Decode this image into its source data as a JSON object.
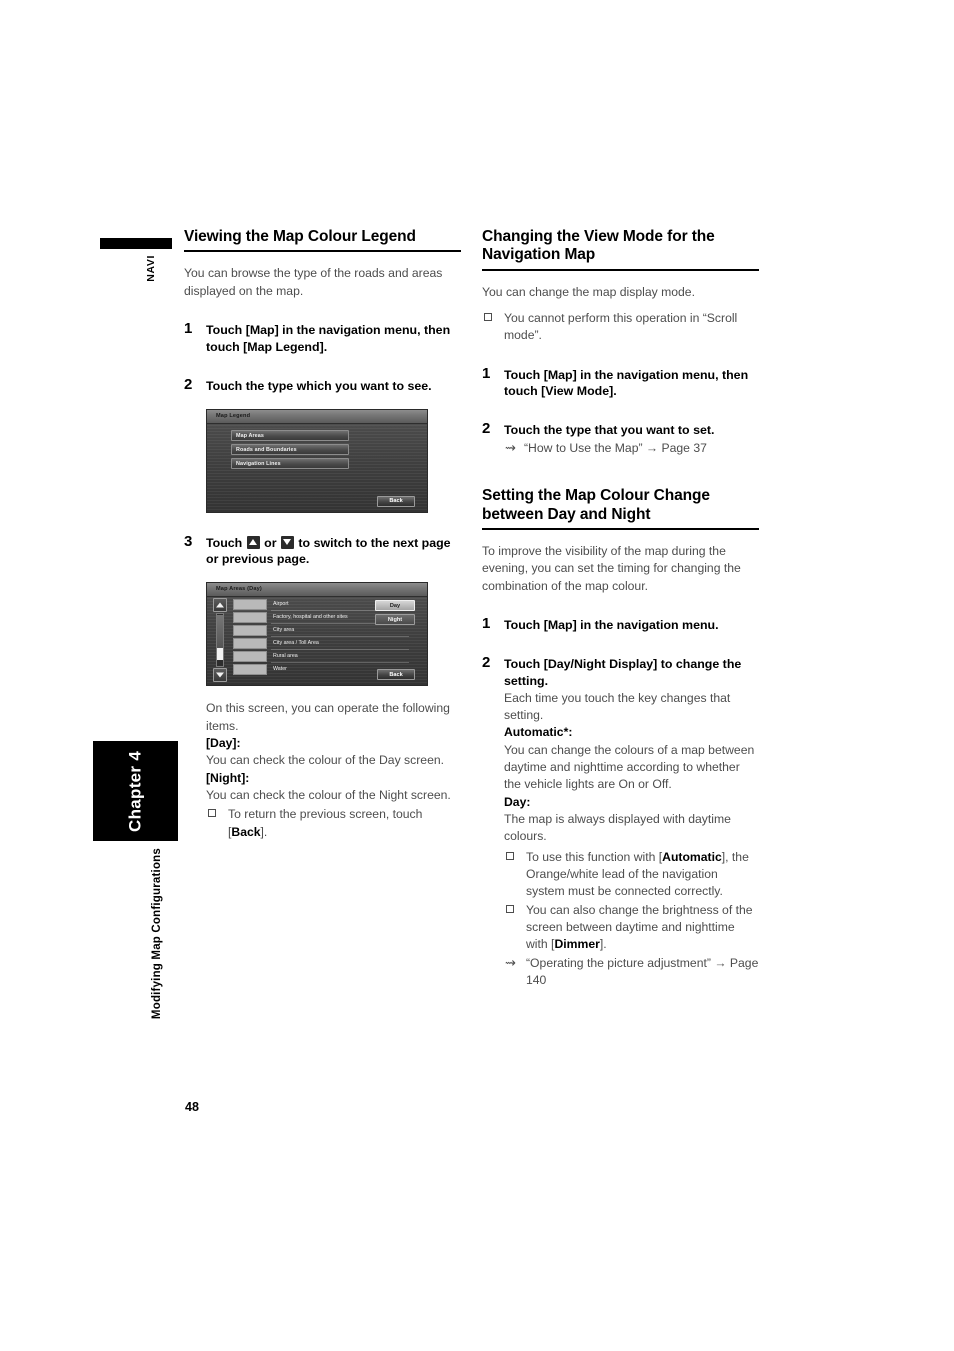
{
  "margin": {
    "navi_label": "NAVI",
    "chapter_tab": "Chapter 4",
    "chapter_subtitle": "Modifying Map Configurations",
    "page_number": "48"
  },
  "left_column": {
    "section_title": "Viewing the Map Colour Legend",
    "intro": "You can browse the type of the roads and areas displayed on the map.",
    "step1_num": "1",
    "step1_text": "Touch [Map] in the navigation menu, then touch [Map Legend].",
    "step2_num": "2",
    "step2_text": "Touch the type which you want to see.",
    "step3_num": "3",
    "step3_text_a": "Touch ",
    "step3_text_b": " or ",
    "step3_text_c": " to switch to the next page or previous page.",
    "after_shot_intro": "On this screen, you can operate the following items.",
    "day_label": "[Day]:",
    "day_text": "You can check the colour of the Day screen.",
    "night_label": "[Night]:",
    "night_text": "You can check the colour of the Night screen.",
    "note_back_a": "To return the previous screen, touch",
    "note_back_b": "[",
    "note_back_bold": "Back",
    "note_back_c": "]."
  },
  "shot_map_legend": {
    "title": "Map Legend",
    "buttons": [
      "Map Areas",
      "Roads and Boundaries",
      "Navigation Lines"
    ],
    "back_label": "Back"
  },
  "shot_map_areas": {
    "title": "Map Areas (Day)",
    "rows": [
      "Airport",
      "Factory, hospital and other sites",
      "City area",
      "City area / Toll Area",
      "Rural area",
      "Water"
    ],
    "day_label": "Day",
    "night_label": "Night",
    "back_label": "Back"
  },
  "right_column": {
    "section1_title": "Changing the View Mode for the Navigation Map",
    "section1_intro": "You can change the map display mode.",
    "section1_note": "You cannot perform this operation in “Scroll mode”.",
    "s1_step1_num": "1",
    "s1_step1_text": "Touch [Map] in the navigation menu, then touch [View Mode].",
    "s1_step2_num": "2",
    "s1_step2_text": "Touch the type that you want to set.",
    "s1_step2_xref": "“How to Use the Map” → Page 37",
    "section2_title": "Setting the Map Colour Change between Day and Night",
    "section2_intro": "To improve the visibility of the map during the evening, you can set the timing for changing the combination of the map colour.",
    "s2_step1_num": "1",
    "s2_step1_text": "Touch [Map] in the navigation menu.",
    "s2_step2_num": "2",
    "s2_step2_text": "Touch [Day/Night Display] to change the setting.",
    "s2_step2_note": "Each time you touch the key changes that setting.",
    "automatic_label": "Automatic*:",
    "automatic_text": "You can change the colours of a map between daytime and nighttime according to whether the vehicle lights are On or Off.",
    "day_label": "Day:",
    "day_text": "The map is always displayed with daytime colours.",
    "note1_a": "To use this function with [",
    "note1_bold": "Automatic",
    "note1_b": "], the Orange/white lead of the navigation system must be connected correctly.",
    "note2_a": "You can also change the brightness of the screen between daytime and nighttime with [",
    "note2_bold": "Dimmer",
    "note2_b": "].",
    "xref2": "“Operating the picture adjustment” → Page 140"
  },
  "colors": {
    "text_body": "#4d4d4d",
    "text_heading": "#000000",
    "rule": "#000000",
    "tab_bg": "#000000"
  }
}
